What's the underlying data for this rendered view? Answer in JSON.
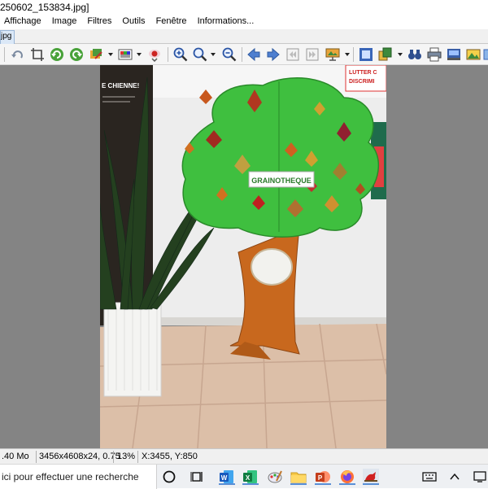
{
  "window": {
    "title": "250602_153834.jpg]",
    "tab_label": "jpg"
  },
  "menu": [
    "Affichage",
    "Image",
    "Filtres",
    "Outils",
    "Fenêtre",
    "Informations..."
  ],
  "photo": {
    "sign_text": "GRAINOTHEQUE",
    "poster_left_text": "E CHIENNE!",
    "poster_right_line1": "LUTTER C",
    "poster_right_line2": "DISCRIMI"
  },
  "status": {
    "filesize": ".40 Mo",
    "dimensions": "3456x4608x24, 0.75",
    "zoom": "13%",
    "cursor": "X:3455, Y:850"
  },
  "taskbar": {
    "search_text": "ici pour effectuer une recherche"
  },
  "colors": {
    "viewer_background": "#848484",
    "tree_green": "#3fbf3f",
    "trunk_orange": "#c8681e",
    "accent_blue": "#5a8fd6"
  }
}
